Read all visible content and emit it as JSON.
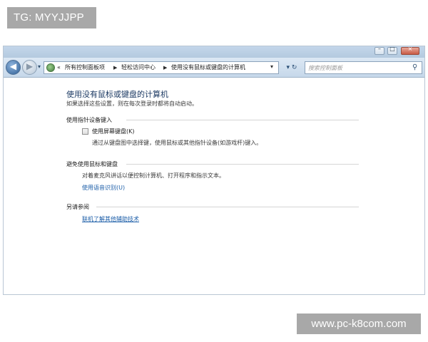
{
  "watermarks": {
    "top": "TG: MYYJJPP",
    "bottom": "www.pc-k8com.com"
  },
  "window": {
    "title_buttons": {
      "minimize": "–",
      "maximize": "□",
      "close": "×"
    }
  },
  "navbar": {
    "back_glyph": "◀",
    "forward_glyph": "▶",
    "recent_glyph": "▾",
    "breadcrumb_lead": "«",
    "breadcrumbs": [
      "所有控制面板项",
      "轻松访问中心",
      "使用没有鼠标或键盘的计算机"
    ],
    "breadcrumb_sep": "▶",
    "address_dropdown": "▾",
    "refresh_glyph": "▾ ↻",
    "search_placeholder": "搜索控制面板",
    "icons": {
      "back": "back-arrow-icon",
      "forward": "forward-arrow-icon",
      "address": "control-panel-icon",
      "search": "magnifier-icon"
    }
  },
  "content": {
    "title": "使用没有鼠标或键盘的计算机",
    "description": "如果选择这些设置，则在每次登录时都将自动启动。",
    "section_pointing": {
      "heading": "使用指针设备键入",
      "checkbox_label": "使用屏幕键盘(K)",
      "checkbox_checked": false,
      "option_description": "通过从键盘图中选择键，使用鼠标或其他指针设备(如游戏杆)键入。"
    },
    "section_speech": {
      "heading": "避免使用鼠标和键盘",
      "description": "对着麦克风讲话以便控制计算机、打开程序和指示文本。",
      "link": "使用语音识别(U)"
    },
    "section_see_also": {
      "heading": "另请参阅",
      "link": "联机了解其他辅助技术"
    }
  },
  "colors": {
    "title_text": "#1c3a63",
    "link": "#1c5ea8",
    "navbar_top": "#dce8f4",
    "watermark_bg": "#a8a8a8"
  }
}
